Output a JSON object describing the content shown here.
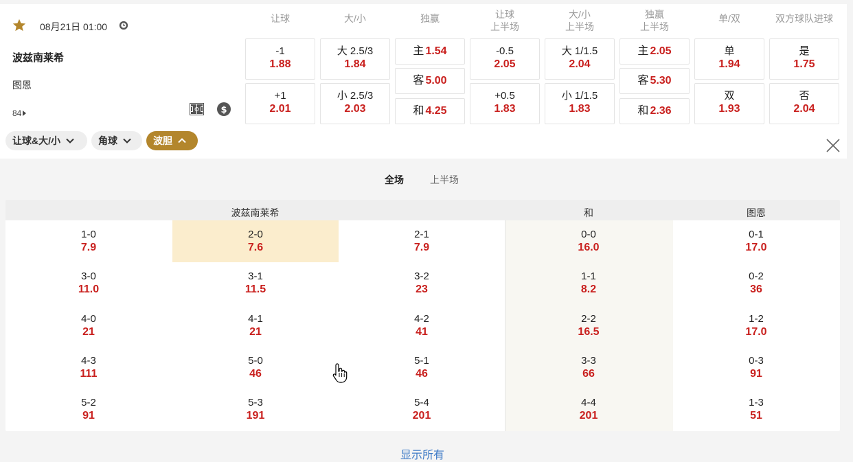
{
  "match": {
    "datetime": "08月21日 01:00",
    "home_team": "波兹南莱希",
    "away_team": "图恩",
    "more_markets": "84"
  },
  "columns": [
    "让球",
    "大/小",
    "独赢",
    "让球\n上半场",
    "大/小\n上半场",
    "独赢\n上半场",
    "单/双",
    "双方球队进球"
  ],
  "odds": {
    "handicap": [
      {
        "label": "-1",
        "value": "1.88"
      },
      {
        "label": "+1",
        "value": "2.01"
      }
    ],
    "over_under": [
      {
        "label": "大 2.5/3",
        "value": "1.84"
      },
      {
        "label": "小 2.5/3",
        "value": "2.03"
      }
    ],
    "moneyline": [
      {
        "label": "主",
        "value": "1.54"
      },
      {
        "label": "客",
        "value": "5.00"
      },
      {
        "label": "和",
        "value": "4.25"
      }
    ],
    "handicap_1h": [
      {
        "label": "-0.5",
        "value": "2.05"
      },
      {
        "label": "+0.5",
        "value": "1.83"
      }
    ],
    "over_under_1h": [
      {
        "label": "大 1/1.5",
        "value": "2.04"
      },
      {
        "label": "小 1/1.5",
        "value": "1.83"
      }
    ],
    "moneyline_1h": [
      {
        "label": "主",
        "value": "2.05"
      },
      {
        "label": "客",
        "value": "5.30"
      },
      {
        "label": "和",
        "value": "2.36"
      }
    ],
    "odd_even": [
      {
        "label": "单",
        "value": "1.94"
      },
      {
        "label": "双",
        "value": "1.93"
      }
    ],
    "btts": [
      {
        "label": "是",
        "value": "1.75"
      },
      {
        "label": "否",
        "value": "2.04"
      }
    ]
  },
  "filters": [
    {
      "label": "让球&大/小",
      "active": false
    },
    {
      "label": "角球",
      "active": false
    },
    {
      "label": "波胆",
      "active": true
    }
  ],
  "tabs": [
    {
      "label": "全场",
      "active": true
    },
    {
      "label": "上半场",
      "active": false
    }
  ],
  "score_table": {
    "headers": {
      "home": "波兹南莱希",
      "draw": "和",
      "away": "图恩"
    },
    "rows": [
      [
        {
          "score": "1-0",
          "odds": "7.9"
        },
        {
          "score": "2-0",
          "odds": "7.6"
        },
        {
          "score": "2-1",
          "odds": "7.9"
        },
        {
          "score": "0-0",
          "odds": "16.0"
        },
        {
          "score": "0-1",
          "odds": "17.0"
        }
      ],
      [
        {
          "score": "3-0",
          "odds": "11.0"
        },
        {
          "score": "3-1",
          "odds": "11.5"
        },
        {
          "score": "3-2",
          "odds": "23"
        },
        {
          "score": "1-1",
          "odds": "8.2"
        },
        {
          "score": "0-2",
          "odds": "36"
        }
      ],
      [
        {
          "score": "4-0",
          "odds": "21"
        },
        {
          "score": "4-1",
          "odds": "21"
        },
        {
          "score": "4-2",
          "odds": "41"
        },
        {
          "score": "2-2",
          "odds": "16.5"
        },
        {
          "score": "1-2",
          "odds": "17.0"
        }
      ],
      [
        {
          "score": "4-3",
          "odds": "111"
        },
        {
          "score": "5-0",
          "odds": "46"
        },
        {
          "score": "5-1",
          "odds": "46"
        },
        {
          "score": "3-3",
          "odds": "66"
        },
        {
          "score": "0-3",
          "odds": "91"
        }
      ],
      [
        {
          "score": "5-2",
          "odds": "91"
        },
        {
          "score": "5-3",
          "odds": "191"
        },
        {
          "score": "5-4",
          "odds": "201"
        },
        {
          "score": "4-4",
          "odds": "201"
        },
        {
          "score": "1-3",
          "odds": "51"
        }
      ]
    ]
  },
  "show_all": "显示所有",
  "colors": {
    "accent": "#b3862c",
    "odds_red": "#c9201e",
    "highlight": "#fbedcd",
    "link": "#3d7ac6"
  },
  "icons": [
    "star-icon",
    "clock-icon",
    "chevron-right-icon",
    "field-icon",
    "coin-icon",
    "chevron-down-icon",
    "chevron-up-icon",
    "close-icon",
    "hand-cursor-icon"
  ]
}
